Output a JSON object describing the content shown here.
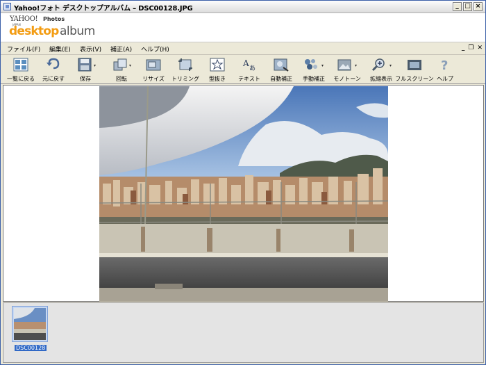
{
  "window": {
    "title": "Yahoo!フォト デスクトップアルバム – DSC00128.JPG",
    "minimize": "_",
    "maximize": "□",
    "close": "×"
  },
  "logo": {
    "yahoo": "YAHOO!",
    "photos": "Photos",
    "japan": "JAPAN",
    "desktop": "desktop",
    "album": "album"
  },
  "menu": {
    "items": [
      "ファイル(F)",
      "編集(E)",
      "表示(V)",
      "補正(A)",
      "ヘルプ(H)"
    ],
    "mdi_min": "_",
    "mdi_restore": "❐",
    "mdi_close": "✕"
  },
  "toolbar": {
    "items": [
      {
        "label": "一覧に戻る",
        "icon": "grid-icon"
      },
      {
        "label": "元に戻す",
        "icon": "undo-icon"
      },
      {
        "label": "保存",
        "icon": "floppy-icon"
      },
      {
        "label": "回転",
        "icon": "rotate-icon"
      },
      {
        "label": "リサイズ",
        "icon": "resize-icon"
      },
      {
        "label": "トリミング",
        "icon": "crop-icon"
      },
      {
        "label": "型抜き",
        "icon": "star-frame-icon"
      },
      {
        "label": "テキスト",
        "icon": "text-icon"
      },
      {
        "label": "自動補正",
        "icon": "auto-correct-icon"
      },
      {
        "label": "手動補正",
        "icon": "manual-correct-icon"
      },
      {
        "label": "モノトーン",
        "icon": "monotone-icon"
      },
      {
        "label": "拡縮表示",
        "icon": "zoom-icon"
      },
      {
        "label": "フルスクリーン",
        "icon": "fullscreen-icon"
      },
      {
        "label": "ヘルプ",
        "icon": "help-icon"
      }
    ]
  },
  "thumbnails": [
    {
      "label": "DSC00128",
      "selected": true
    }
  ],
  "colors": {
    "accent": "#f39c12",
    "selection": "#3169c6"
  }
}
